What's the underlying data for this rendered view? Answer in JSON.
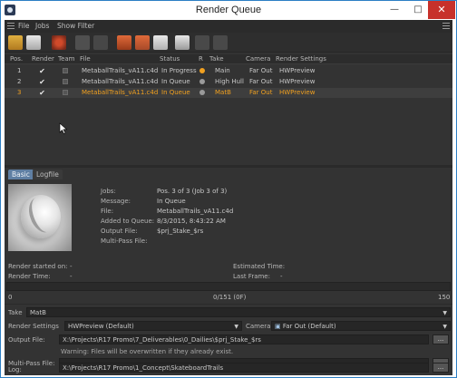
{
  "window": {
    "title": "Render Queue"
  },
  "menu": {
    "items": [
      "File",
      "Jobs",
      "Show Filter"
    ]
  },
  "queue": {
    "columns": [
      "Pos.",
      "Render",
      "Team",
      "File",
      "Status",
      "R",
      "Take",
      "Camera",
      "Render Settings"
    ],
    "rows": [
      {
        "pos": "1",
        "file": "MetaballTrails_vA11.c4d",
        "status": "In Progress",
        "status_color": "#f0a020",
        "take": "Main",
        "camera": "Far Out",
        "settings": "HWPreview"
      },
      {
        "pos": "2",
        "file": "MetaballTrails_vA11.c4d",
        "status": "In Queue",
        "status_color": "#9a9a9a",
        "take": "High Hull",
        "camera": "Far Out",
        "settings": "HWPreview"
      },
      {
        "pos": "3",
        "file": "MetaballTrails_vA11.c4d",
        "status": "In Queue",
        "status_color": "#9a9a9a",
        "take": "MatB",
        "camera": "Far Out",
        "settings": "HWPreview"
      }
    ]
  },
  "tabs": [
    "Basic",
    "Logfile"
  ],
  "job_info": {
    "jobs_label": "Jobs:",
    "jobs_value": "Pos. 3 of 3 (Job 3 of 3)",
    "message_label": "Message:",
    "message_value": "In Queue",
    "file_label": "File:",
    "file_value": "MetaballTrails_vA11.c4d",
    "added_label": "Added to Queue:",
    "added_value": "8/3/2015, 8:43:22 AM",
    "output_label": "Output File:",
    "output_value": "$prj_Stake_$rs",
    "multipass_label": "Multi-Pass File:",
    "multipass_value": ""
  },
  "stats": {
    "started_label": "Render started on:",
    "started_value": "-",
    "time_label": "Render Time:",
    "time_value": "-",
    "estimated_label": "Estimated Time:",
    "estimated_value": "-",
    "lastframe_label": "Last Frame:",
    "lastframe_value": "-"
  },
  "progress": {
    "start": "0",
    "frames": "0/151 (0F)",
    "end": "150",
    "fraction": 0
  },
  "settings": {
    "take_label": "Take",
    "take_value": "MatB",
    "rs_label": "Render Settings",
    "rs_value": "HWPreview (Default)",
    "camera_label": "Camera",
    "camera_value": "Far Out (Default)",
    "output_label": "Output File:",
    "output_value": "X:\\Projects\\R17 Promo\\7_Deliverables\\0_Dailies\\$prj_Stake_$rs",
    "warning": "Warning: Files will be overwritten if they already exist.",
    "multipass_label": "Multi-Pass File:",
    "multipass_value": "",
    "log_label": "Log:",
    "log_value": "X:\\Projects\\R17 Promo\\1_Concept\\SkateboardTrails",
    "browse_label": "..."
  }
}
